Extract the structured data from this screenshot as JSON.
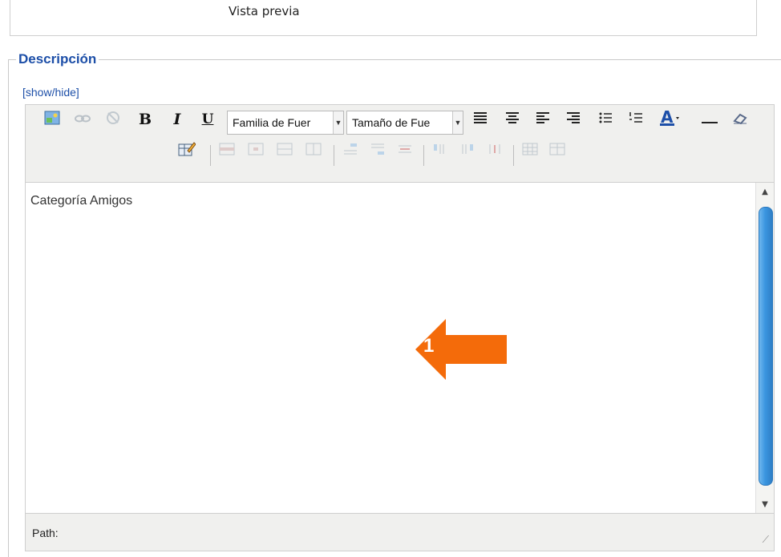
{
  "preview": {
    "label": "Vista previa"
  },
  "section": {
    "legend": "Descripción",
    "toggle": "[show/hide]"
  },
  "toolbar": {
    "font_family": "Familia de Fuer",
    "font_size": "Tamaño de Fue",
    "row1_icons": [
      "image-icon",
      "link-icon",
      "unlink-icon",
      "bold-icon",
      "italic-icon",
      "underline-icon",
      "align-justify-icon",
      "align-center-icon",
      "align-left-icon",
      "align-right-icon",
      "bullet-list-icon",
      "numbered-list-icon",
      "text-color-icon",
      "horizontal-rule-icon",
      "eraser-icon"
    ],
    "row2_icons": [
      "edit-table-icon",
      "table-row-props-icon",
      "table-cell-props-icon",
      "merge-cells-icon",
      "split-cells-icon",
      "insert-row-before-icon",
      "insert-row-after-icon",
      "delete-row-icon",
      "insert-col-before-icon",
      "insert-col-after-icon",
      "delete-col-icon",
      "table-icon",
      "delete-table-icon"
    ]
  },
  "editor": {
    "content": "Categoría Amigos"
  },
  "status": {
    "path": "Path:"
  },
  "annotation": {
    "number": "1",
    "color": "#f46b0a"
  }
}
